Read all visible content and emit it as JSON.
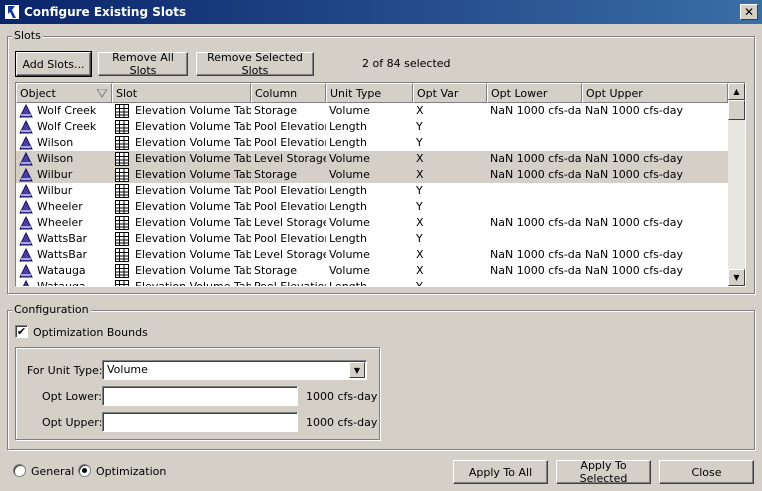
{
  "window": {
    "title": "Configure Existing Slots",
    "close_glyph": "✕"
  },
  "slots_group": {
    "label": "Slots",
    "add_button": "Add Slots...",
    "remove_all_button": "Remove All Slots",
    "remove_selected_button": "Remove Selected Slots",
    "selection_status": "2 of 84 selected"
  },
  "table": {
    "columns": [
      "Object",
      "Slot",
      "Column",
      "Unit Type",
      "Opt Var",
      "Opt Lower",
      "Opt Upper"
    ],
    "rows": [
      {
        "object": "Wolf Creek",
        "slot": "Elevation Volume Table",
        "column": "Storage",
        "unit": "Volume",
        "optvar": "X",
        "lower": "NaN 1000 cfs-day",
        "upper": "NaN 1000 cfs-day",
        "selected": false
      },
      {
        "object": "Wolf Creek",
        "slot": "Elevation Volume Table",
        "column": "Pool Elevation",
        "unit": "Length",
        "optvar": "Y",
        "lower": "",
        "upper": "",
        "selected": false
      },
      {
        "object": "Wilson",
        "slot": "Elevation Volume Table",
        "column": "Pool Elevation",
        "unit": "Length",
        "optvar": "Y",
        "lower": "",
        "upper": "",
        "selected": false
      },
      {
        "object": "Wilson",
        "slot": "Elevation Volume Table",
        "column": "Level Storage",
        "unit": "Volume",
        "optvar": "X",
        "lower": "NaN 1000 cfs-day",
        "upper": "NaN 1000 cfs-day",
        "selected": true
      },
      {
        "object": "Wilbur",
        "slot": "Elevation Volume Table",
        "column": "Storage",
        "unit": "Volume",
        "optvar": "X",
        "lower": "NaN 1000 cfs-day",
        "upper": "NaN 1000 cfs-day",
        "selected": true
      },
      {
        "object": "Wilbur",
        "slot": "Elevation Volume Table",
        "column": "Pool Elevation",
        "unit": "Length",
        "optvar": "Y",
        "lower": "",
        "upper": "",
        "selected": false
      },
      {
        "object": "Wheeler",
        "slot": "Elevation Volume Table",
        "column": "Pool Elevation",
        "unit": "Length",
        "optvar": "Y",
        "lower": "",
        "upper": "",
        "selected": false
      },
      {
        "object": "Wheeler",
        "slot": "Elevation Volume Table",
        "column": "Level Storage",
        "unit": "Volume",
        "optvar": "X",
        "lower": "NaN 1000 cfs-day",
        "upper": "NaN 1000 cfs-day",
        "selected": false
      },
      {
        "object": "WattsBar",
        "slot": "Elevation Volume Table",
        "column": "Pool Elevation",
        "unit": "Length",
        "optvar": "Y",
        "lower": "",
        "upper": "",
        "selected": false
      },
      {
        "object": "WattsBar",
        "slot": "Elevation Volume Table",
        "column": "Level Storage",
        "unit": "Volume",
        "optvar": "X",
        "lower": "NaN 1000 cfs-day",
        "upper": "NaN 1000 cfs-day",
        "selected": false
      },
      {
        "object": "Watauga",
        "slot": "Elevation Volume Table",
        "column": "Storage",
        "unit": "Volume",
        "optvar": "X",
        "lower": "NaN 1000 cfs-day",
        "upper": "NaN 1000 cfs-day",
        "selected": false
      },
      {
        "object": "Watauga",
        "slot": "Elevation Volume Table",
        "column": "Pool Elevation",
        "unit": "Length",
        "optvar": "Y",
        "lower": "",
        "upper": "",
        "selected": false
      }
    ]
  },
  "config_group": {
    "label": "Configuration",
    "opt_bounds_label": "Optimization Bounds",
    "opt_bounds_checked": true,
    "unit_type_label": "For Unit Type:",
    "unit_type_value": "Volume",
    "opt_lower_label": "Opt Lower:",
    "opt_lower_value": "",
    "opt_lower_unit": "1000 cfs-day",
    "opt_upper_label": "Opt Upper:",
    "opt_upper_value": "",
    "opt_upper_unit": "1000 cfs-day"
  },
  "footer": {
    "radio_general": "General",
    "radio_optimization": "Optimization",
    "selected_mode": "Optimization",
    "apply_all": "Apply To All",
    "apply_selected": "Apply To Selected",
    "close": "Close"
  },
  "colors": {
    "selected_row": "#d4d0c8",
    "object_icon": "#4a3fa0"
  }
}
